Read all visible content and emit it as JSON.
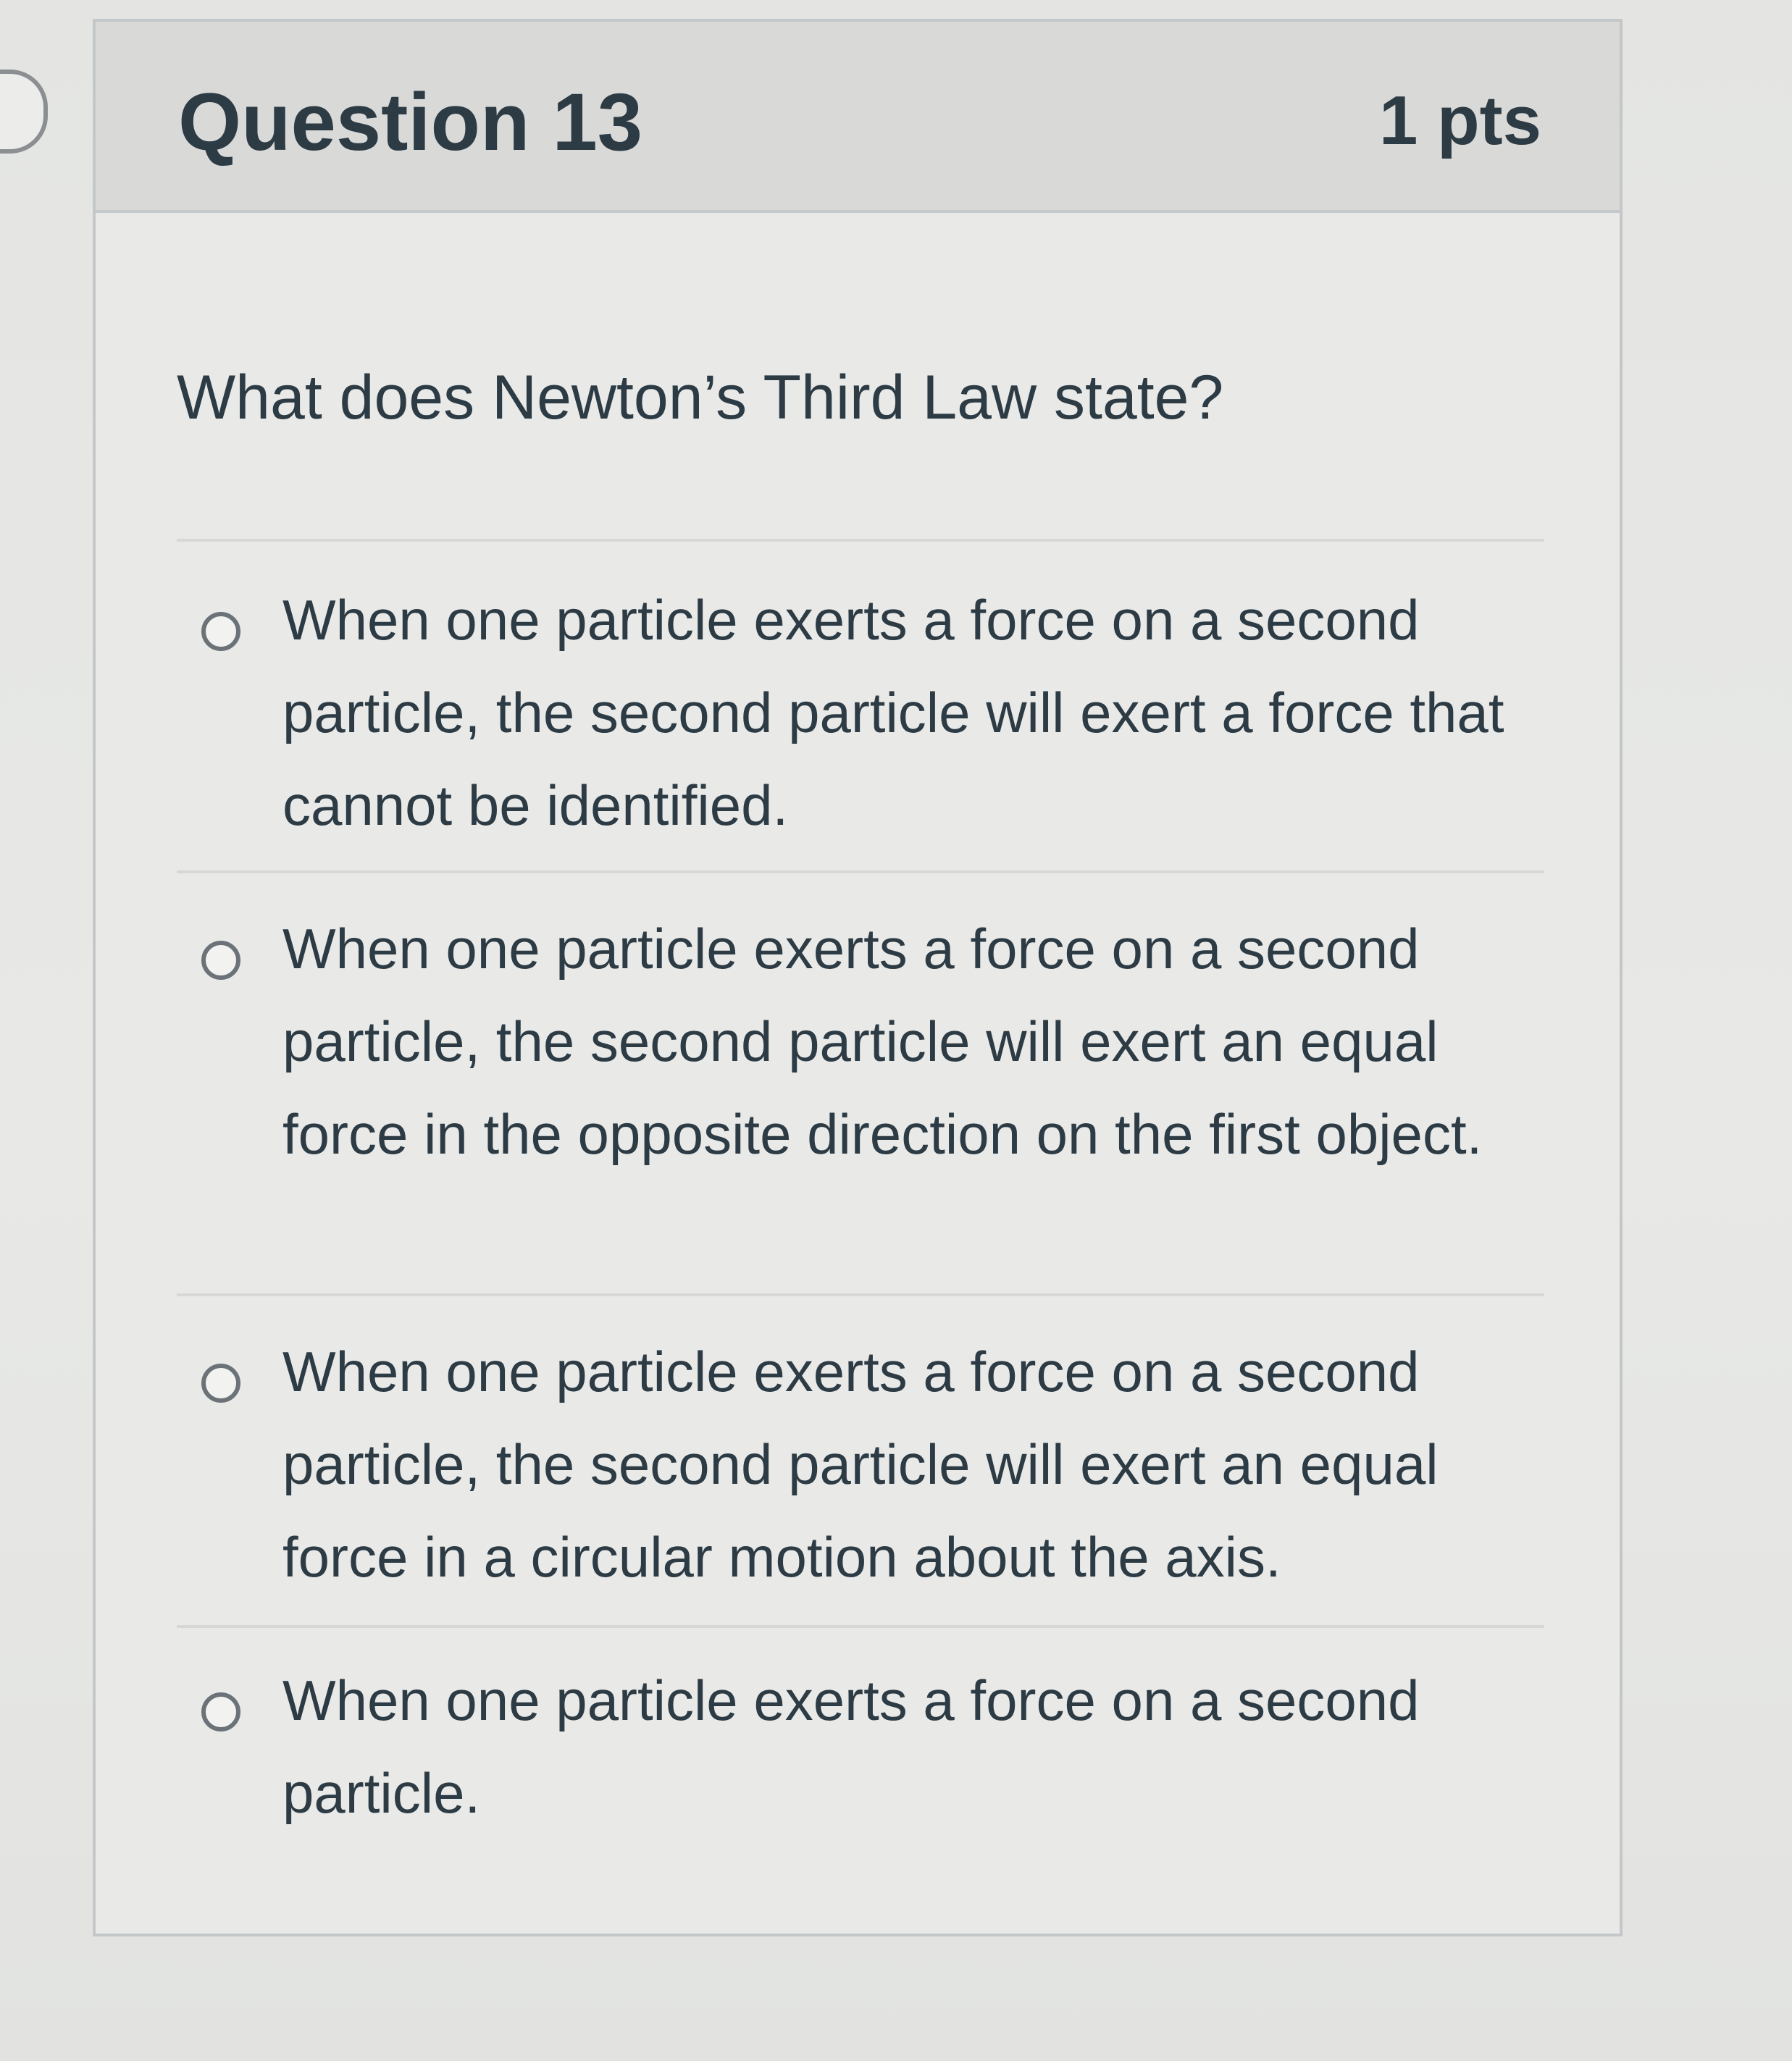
{
  "question": {
    "title": "Question 13",
    "points": "1 pts",
    "text": "What does Newton’s Third Law state?"
  },
  "answers": [
    {
      "label": "When one particle exerts a force on a second particle, the second particle will exert a force that cannot be identified.",
      "selected": false
    },
    {
      "label": "When one particle exerts a force on a second particle, the second particle will exert an equal force in the opposite direction on the first object.",
      "selected": false
    },
    {
      "label": "When one particle exerts a force on a second particle, the second particle will exert an equal force in a circular motion about the axis.",
      "selected": false
    },
    {
      "label": "When one particle exerts a force on a second particle.",
      "selected": false
    }
  ],
  "icons": {
    "radio": "radio-circle-icon",
    "nav_flag": "question-flag-icon"
  },
  "colors": {
    "text": "#2d3b45",
    "header_bg": "#d9dad8",
    "card_border": "#c4c7c8",
    "radio_border": "#6c7378"
  }
}
